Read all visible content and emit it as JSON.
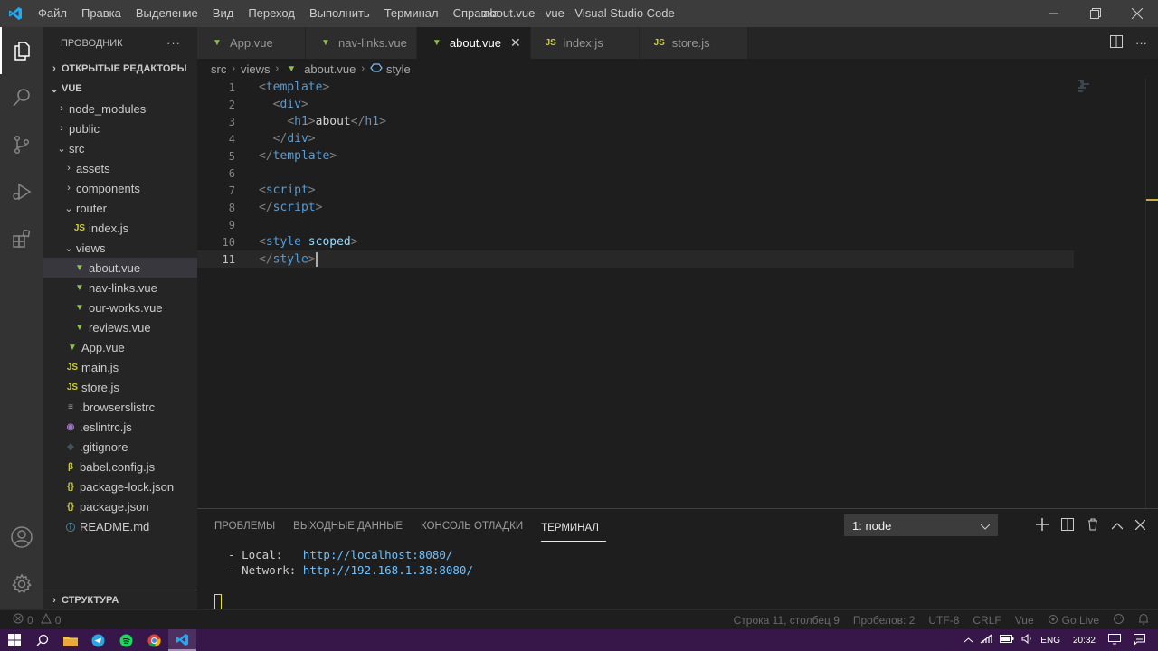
{
  "titlebar": {
    "title": "about.vue - vue - Visual Studio Code",
    "menu": [
      "Файл",
      "Правка",
      "Выделение",
      "Вид",
      "Переход",
      "Выполнить",
      "Терминал",
      "Справка"
    ]
  },
  "sidebar": {
    "title": "ПРОВОДНИК",
    "more": "···",
    "open_editors": "ОТКРЫТЫЕ РЕДАКТОРЫ",
    "project": "VUE",
    "tree": [
      {
        "label": "node_modules",
        "kind": "folder-closed",
        "depth": 1
      },
      {
        "label": "public",
        "kind": "folder-closed",
        "depth": 1
      },
      {
        "label": "src",
        "kind": "folder-open",
        "depth": 1
      },
      {
        "label": "assets",
        "kind": "folder-closed",
        "depth": 2
      },
      {
        "label": "components",
        "kind": "folder-closed",
        "depth": 2
      },
      {
        "label": "router",
        "kind": "folder-open",
        "depth": 2
      },
      {
        "label": "index.js",
        "kind": "js",
        "depth": 3
      },
      {
        "label": "views",
        "kind": "folder-open",
        "depth": 2
      },
      {
        "label": "about.vue",
        "kind": "vue",
        "depth": 3,
        "selected": true
      },
      {
        "label": "nav-links.vue",
        "kind": "vue",
        "depth": 3
      },
      {
        "label": "our-works.vue",
        "kind": "vue",
        "depth": 3
      },
      {
        "label": "reviews.vue",
        "kind": "vue",
        "depth": 3
      },
      {
        "label": "App.vue",
        "kind": "vue",
        "depth": 2
      },
      {
        "label": "main.js",
        "kind": "js",
        "depth": 2
      },
      {
        "label": "store.js",
        "kind": "js",
        "depth": 2
      },
      {
        "label": ".browserslistrc",
        "kind": "list",
        "depth": 1
      },
      {
        "label": ".eslintrc.js",
        "kind": "eslint",
        "depth": 1
      },
      {
        "label": ".gitignore",
        "kind": "git",
        "depth": 1
      },
      {
        "label": "babel.config.js",
        "kind": "babel",
        "depth": 1
      },
      {
        "label": "package-lock.json",
        "kind": "json",
        "depth": 1
      },
      {
        "label": "package.json",
        "kind": "json",
        "depth": 1
      },
      {
        "label": "README.md",
        "kind": "info",
        "depth": 1
      }
    ],
    "outline": "СТРУКТУРА"
  },
  "tabs": [
    {
      "label": "App.vue",
      "kind": "vue"
    },
    {
      "label": "nav-links.vue",
      "kind": "vue"
    },
    {
      "label": "about.vue",
      "kind": "vue",
      "active": true
    },
    {
      "label": "index.js",
      "kind": "js"
    },
    {
      "label": "store.js",
      "kind": "js"
    }
  ],
  "breadcrumb": [
    "src",
    "views",
    "about.vue",
    "style"
  ],
  "editor": {
    "current_line": 11,
    "lines": [
      {
        "n": "1",
        "tokens": [
          [
            "tg",
            "<"
          ],
          [
            "tn",
            "template"
          ],
          [
            "tg",
            ">"
          ]
        ]
      },
      {
        "n": "2",
        "tokens": [
          [
            "tx",
            "  "
          ],
          [
            "tg",
            "<"
          ],
          [
            "tn",
            "div"
          ],
          [
            "tg",
            ">"
          ]
        ]
      },
      {
        "n": "3",
        "tokens": [
          [
            "tx",
            "    "
          ],
          [
            "tg",
            "<"
          ],
          [
            "tn",
            "h1"
          ],
          [
            "tg",
            ">"
          ],
          [
            "tx",
            "about"
          ],
          [
            "tg",
            "</"
          ],
          [
            "tn",
            "h1"
          ],
          [
            "tg",
            ">"
          ]
        ]
      },
      {
        "n": "4",
        "tokens": [
          [
            "tx",
            "  "
          ],
          [
            "tg",
            "</"
          ],
          [
            "tn",
            "div"
          ],
          [
            "tg",
            ">"
          ]
        ]
      },
      {
        "n": "5",
        "tokens": [
          [
            "tg",
            "</"
          ],
          [
            "tn",
            "template"
          ],
          [
            "tg",
            ">"
          ]
        ]
      },
      {
        "n": "6",
        "tokens": []
      },
      {
        "n": "7",
        "tokens": [
          [
            "tg",
            "<"
          ],
          [
            "tn",
            "script"
          ],
          [
            "tg",
            ">"
          ]
        ]
      },
      {
        "n": "8",
        "tokens": [
          [
            "tg",
            "</"
          ],
          [
            "tn",
            "script"
          ],
          [
            "tg",
            ">"
          ]
        ]
      },
      {
        "n": "9",
        "tokens": []
      },
      {
        "n": "10",
        "tokens": [
          [
            "tg",
            "<"
          ],
          [
            "tn",
            "style"
          ],
          [
            "tx",
            " "
          ],
          [
            "at",
            "scoped"
          ],
          [
            "tg",
            ">"
          ]
        ]
      },
      {
        "n": "11",
        "tokens": [
          [
            "tg",
            "</"
          ],
          [
            "tn",
            "style"
          ],
          [
            "tg",
            ">"
          ]
        ]
      }
    ]
  },
  "panel": {
    "tabs": [
      "ПРОБЛЕМЫ",
      "ВЫХОДНЫЕ ДАННЫЕ",
      "КОНСОЛЬ ОТЛАДКИ",
      "ТЕРМИНАЛ"
    ],
    "active_tab": 3,
    "terminal_select": "1: node",
    "terminal_lines": [
      {
        "prefix": "  - Local:   ",
        "url": "http://localhost:8080/"
      },
      {
        "prefix": "  - Network: ",
        "url": "http://192.168.1.38:8080/"
      }
    ]
  },
  "statusbar": {
    "errors": "0",
    "warnings": "0",
    "position": "Строка 11, столбец 9",
    "spaces": "Пробелов: 2",
    "encoding": "UTF-8",
    "eol": "CRLF",
    "language": "Vue",
    "golive": "Go Live"
  },
  "taskbar": {
    "lang": "ENG",
    "time": "20:32"
  },
  "colors": {
    "vue": "#8dc149",
    "js": "#cbcb41",
    "tag": "#569cd6",
    "taskbar": "#37174a"
  }
}
